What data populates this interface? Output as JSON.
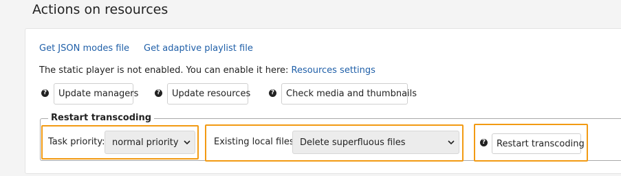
{
  "page": {
    "title": "Actions on resources"
  },
  "links": {
    "json_modes": "Get JSON modes file",
    "adaptive_playlist": "Get adaptive playlist file"
  },
  "static_player": {
    "text": "The static player is not enabled. You can enable it here: ",
    "link": "Resources settings"
  },
  "buttons": {
    "update_managers": "Update managers",
    "update_resources": "Update resources",
    "check_media": "Check media and thumbnails"
  },
  "restart": {
    "legend": "Restart transcoding",
    "task_priority_label": "Task priority:",
    "task_priority_value": "normal priority",
    "existing_files_label": "Existing local files:",
    "existing_files_value": "Delete superfluous files",
    "restart_button": "Restart transcoding"
  },
  "icons": {
    "help": "question-circle-icon",
    "dropdown": "chevron-down-icon"
  },
  "colors": {
    "link": "#1f5fa8",
    "highlight": "#f29a12"
  }
}
